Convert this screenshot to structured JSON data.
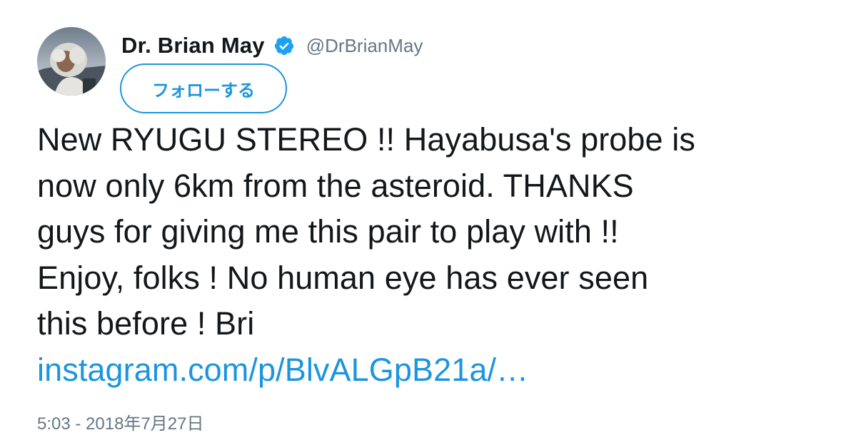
{
  "author": {
    "display_name": "Dr. Brian May",
    "handle": "@DrBrianMay",
    "verified": true
  },
  "follow_button": {
    "label": "フォローする"
  },
  "tweet": {
    "lines": [
      "New RYUGU STEREO !! Hayabusa's probe is",
      "now only 6km from the asteroid. THANKS",
      "guys for giving me this pair to play with !!",
      "Enjoy, folks ! No human eye has ever seen",
      "this before ! Bri"
    ],
    "link_text": "instagram.com/p/BlvALGpB21a/…"
  },
  "timestamp": "5:03 - 2018年7月27日",
  "colors": {
    "text": "#14171a",
    "secondary": "#657786",
    "accent": "#1b95e0",
    "verified_badge": "#1da1f2"
  },
  "icons": {
    "verified": "verified-badge-icon",
    "avatar": "profile-photo"
  }
}
